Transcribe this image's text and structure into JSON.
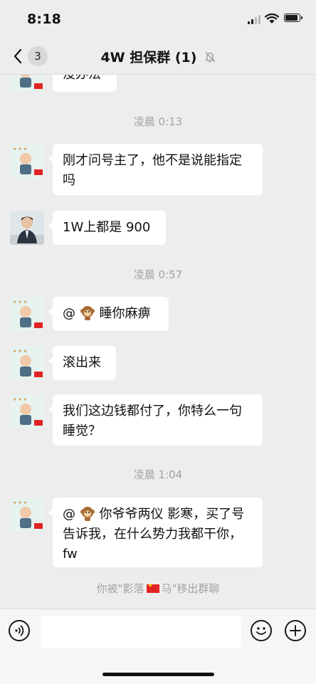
{
  "status": {
    "time": "8:18"
  },
  "nav": {
    "back_count": "3",
    "title": "4W 担保群 (1)"
  },
  "messages": [
    {
      "type": "partial",
      "text": "没办法"
    },
    {
      "type": "time",
      "text": "凌晨 0:13"
    },
    {
      "type": "msg",
      "avatar": "baby",
      "text": "刚才问号主了，他不是说能指定吗"
    },
    {
      "type": "msg",
      "avatar": "man",
      "text": "1W上都是 900"
    },
    {
      "type": "time",
      "text": "凌晨 0:57"
    },
    {
      "type": "msg",
      "avatar": "baby",
      "prefix": "@",
      "text": "睡你麻痹"
    },
    {
      "type": "msg",
      "avatar": "baby",
      "text": "滚出来"
    },
    {
      "type": "msg",
      "avatar": "baby",
      "text": "我们这边钱都付了，你特么一句睡觉？"
    },
    {
      "type": "time",
      "text": "凌晨 1:04"
    },
    {
      "type": "msg",
      "avatar": "baby",
      "prefix": "@",
      "text": "你爷爷两仪 影寒，买了号告诉我，在什么势力我都干你，fw"
    },
    {
      "type": "system",
      "before": "你被\"影落",
      "after": "马\"移出群聊"
    }
  ],
  "icons": {
    "back": "chevron-left-icon",
    "mute": "bell-slash-icon",
    "voice": "voice-icon",
    "emoji": "emoji-icon",
    "plus": "plus-icon"
  }
}
